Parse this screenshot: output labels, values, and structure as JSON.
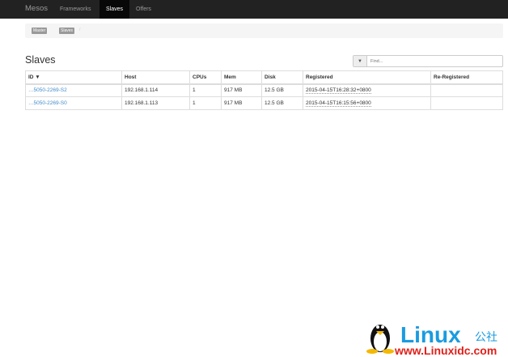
{
  "navbar": {
    "brand": "Mesos",
    "items": [
      {
        "label": "Frameworks"
      },
      {
        "label": "Slaves",
        "active": true
      },
      {
        "label": "Offers"
      }
    ]
  },
  "breadcrumb": {
    "items": [
      "Master",
      "Slaves"
    ],
    "separator": "/"
  },
  "page_title": "Slaves",
  "filter": {
    "icon": "filter-icon",
    "placeholder": "Find...",
    "value": ""
  },
  "table": {
    "headers": [
      "ID ▼",
      "Host",
      "CPUs",
      "Mem",
      "Disk",
      "Registered",
      "Re-Registered"
    ],
    "rows": [
      [
        "…5050-2269-S2",
        "192.168.1.114",
        "1",
        "917 MB",
        "12.5 GB",
        "2015-04-15T16:28:32+0800",
        ""
      ],
      [
        "…5050-2269-S0",
        "192.168.1.113",
        "1",
        "917 MB",
        "12.5 GB",
        "2015-04-15T16:15:56+0800",
        ""
      ]
    ]
  },
  "watermark": {
    "logo_text": "Linux公社",
    "url_text": "www.Linuxidc.com"
  },
  "colors": {
    "navbar": "#222222",
    "link": "#428bca",
    "watermark_blue": "#1a9be0",
    "watermark_red": "#e0201a"
  }
}
